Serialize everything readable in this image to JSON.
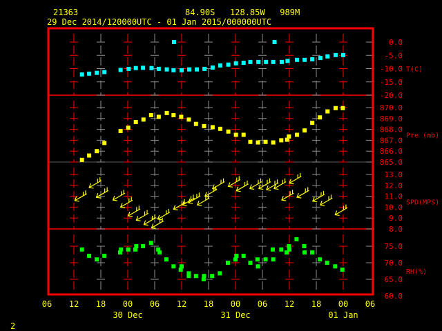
{
  "header": {
    "station_id": "21363",
    "location": "84.90S   128.85W   989M",
    "time_range": "29 Dec 2014/120000UTC - 01 Jan 2015/000000UTC"
  },
  "footer": {
    "page": "2"
  },
  "colors": {
    "frame": "#ff0000",
    "text": "#ffff00",
    "temp": "#00ffff",
    "pressure": "#ffff00",
    "wind": "#ffff00",
    "rh": "#00ff00",
    "grid_alt": "#909090"
  },
  "chart_data": {
    "type": "scatter",
    "time_unit": "hours since 29 Dec 06Z",
    "x_ticks": {
      "hours": [
        0,
        6,
        12,
        18,
        24,
        30,
        36,
        42,
        48,
        54,
        60,
        66,
        72
      ],
      "labels": [
        "06",
        "12",
        "18",
        "00",
        "06",
        "12",
        "18",
        "00",
        "06",
        "12",
        "18",
        "00",
        "06"
      ]
    },
    "date_labels": [
      {
        "hour": 18,
        "text": "30 Dec"
      },
      {
        "hour": 42,
        "text": "31 Dec"
      },
      {
        "hour": 66,
        "text": "01 Jan"
      }
    ],
    "panels": [
      {
        "id": "temp",
        "label": "T(C)",
        "ylim": [
          -20,
          0
        ],
        "ticks": [
          0,
          -5,
          -10,
          -15,
          -20
        ],
        "tick_labels": [
          "0.0",
          "-5.0",
          "-10.0",
          "-15.0",
          "-20.0"
        ],
        "points": [
          [
            7.8,
            -12.2
          ],
          [
            9.4,
            -11.9
          ],
          [
            11.1,
            -11.6
          ],
          [
            12.8,
            -11.3
          ],
          [
            16.4,
            -10.5
          ],
          [
            18.2,
            -10.1
          ],
          [
            19.8,
            -9.8
          ],
          [
            21.4,
            -9.7
          ],
          [
            23.3,
            -9.8
          ],
          [
            24.9,
            -10.1
          ],
          [
            26.7,
            -10.3
          ],
          [
            28.2,
            -10.6
          ],
          [
            30.0,
            -10.6
          ],
          [
            31.7,
            -10.3
          ],
          [
            33.4,
            -10.3
          ],
          [
            35.1,
            -10.1
          ],
          [
            36.9,
            -9.6
          ],
          [
            38.6,
            -8.8
          ],
          [
            40.4,
            -8.5
          ],
          [
            42.1,
            -8.0
          ],
          [
            43.8,
            -7.8
          ],
          [
            45.3,
            -7.5
          ],
          [
            47.1,
            -7.5
          ],
          [
            48.8,
            -7.5
          ],
          [
            50.4,
            -7.5
          ],
          [
            52.3,
            -7.5
          ],
          [
            53.6,
            -7.1
          ],
          [
            55.7,
            -6.7
          ],
          [
            57.4,
            -6.7
          ],
          [
            59.1,
            -6.5
          ],
          [
            60.9,
            -6.0
          ],
          [
            62.5,
            -5.4
          ],
          [
            64.3,
            -4.9
          ],
          [
            66.0,
            -4.9
          ],
          [
            28.3,
            0.0
          ],
          [
            50.7,
            0.0
          ]
        ]
      },
      {
        "id": "pressure",
        "label": "Pre (mb)",
        "ylim": [
          865,
          870
        ],
        "ticks": [
          870,
          869,
          868,
          867,
          866,
          865
        ],
        "tick_labels": [
          "870.0",
          "869.0",
          "868.0",
          "867.0",
          "866.0",
          "865.0"
        ],
        "points": [
          [
            7.8,
            865.2
          ],
          [
            9.4,
            865.6
          ],
          [
            11.1,
            866.0
          ],
          [
            12.8,
            866.75
          ],
          [
            16.4,
            867.85
          ],
          [
            18.1,
            868.15
          ],
          [
            19.8,
            868.67
          ],
          [
            21.5,
            868.9
          ],
          [
            23.2,
            869.3
          ],
          [
            24.9,
            869.15
          ],
          [
            26.7,
            869.5
          ],
          [
            28.2,
            869.3
          ],
          [
            29.9,
            869.15
          ],
          [
            31.6,
            868.9
          ],
          [
            33.2,
            868.5
          ],
          [
            35.0,
            868.3
          ],
          [
            36.9,
            868.2
          ],
          [
            38.6,
            868.05
          ],
          [
            40.4,
            867.8
          ],
          [
            42.1,
            867.5
          ],
          [
            43.8,
            867.5
          ],
          [
            45.3,
            866.85
          ],
          [
            47.0,
            866.8
          ],
          [
            48.7,
            866.85
          ],
          [
            50.4,
            866.8
          ],
          [
            52.2,
            867.0
          ],
          [
            53.5,
            867.05
          ],
          [
            53.9,
            867.35
          ],
          [
            55.7,
            867.5
          ],
          [
            57.4,
            867.9
          ],
          [
            59.1,
            868.6
          ],
          [
            60.8,
            869.1
          ],
          [
            62.5,
            869.65
          ],
          [
            64.3,
            869.95
          ],
          [
            65.9,
            869.95
          ]
        ]
      },
      {
        "id": "wind",
        "label": "SPD(MPS)",
        "ylim": [
          8,
          13
        ],
        "ticks": [
          13,
          12,
          11,
          10,
          9,
          8
        ],
        "tick_labels": [
          "13.0",
          "12.0",
          "11.0",
          "10.0",
          "9.0",
          "8.0"
        ],
        "points": [
          [
            6.2,
            10.6
          ],
          [
            9.4,
            11.8
          ],
          [
            11.0,
            10.9
          ],
          [
            14.7,
            10.65
          ],
          [
            16.4,
            10.0
          ],
          [
            18.1,
            9.2
          ],
          [
            19.9,
            8.8
          ],
          [
            21.6,
            8.4
          ],
          [
            23.3,
            8.1
          ],
          [
            24.7,
            8.9
          ],
          [
            28.2,
            9.8
          ],
          [
            30.2,
            10.2
          ],
          [
            31.5,
            10.4
          ],
          [
            33.5,
            10.2
          ],
          [
            35.2,
            11.0
          ],
          [
            36.9,
            11.7
          ],
          [
            40.4,
            11.9
          ],
          [
            42.2,
            11.5
          ],
          [
            45.2,
            11.7
          ],
          [
            47.2,
            11.7
          ],
          [
            48.9,
            11.6
          ],
          [
            50.6,
            11.7
          ],
          [
            52.3,
            10.65
          ],
          [
            54.0,
            12.2
          ],
          [
            55.7,
            10.9
          ],
          [
            59.2,
            10.55
          ],
          [
            60.9,
            10.2
          ],
          [
            64.2,
            9.3
          ]
        ]
      },
      {
        "id": "rh",
        "label": "RH(%)",
        "ylim": [
          60,
          75
        ],
        "ticks": [
          75,
          70,
          65,
          60
        ],
        "tick_labels": [
          "75.0",
          "70.0",
          "65.0",
          "60.0"
        ],
        "points": [
          [
            7.8,
            74.0
          ],
          [
            9.4,
            72.1
          ],
          [
            11.1,
            71.0
          ],
          [
            12.8,
            72.1
          ],
          [
            16.3,
            73.1
          ],
          [
            16.5,
            74.0
          ],
          [
            18.1,
            74.0
          ],
          [
            19.7,
            74.0
          ],
          [
            19.9,
            75.0
          ],
          [
            21.4,
            75.0
          ],
          [
            23.2,
            76.0
          ],
          [
            24.8,
            74.0
          ],
          [
            25.1,
            73.1
          ],
          [
            26.6,
            71.0
          ],
          [
            28.2,
            68.9
          ],
          [
            29.8,
            67.9
          ],
          [
            30.0,
            68.9
          ],
          [
            31.6,
            66.8
          ],
          [
            31.6,
            66.0
          ],
          [
            33.2,
            66.0
          ],
          [
            34.9,
            65.0
          ],
          [
            35.0,
            66.0
          ],
          [
            36.8,
            66.0
          ],
          [
            38.5,
            66.8
          ],
          [
            40.3,
            70.0
          ],
          [
            42.0,
            71.0
          ],
          [
            42.2,
            72.1
          ],
          [
            43.8,
            72.1
          ],
          [
            45.3,
            70.0
          ],
          [
            46.9,
            71.0
          ],
          [
            47.0,
            68.9
          ],
          [
            48.7,
            71.0
          ],
          [
            50.4,
            71.0
          ],
          [
            50.3,
            74.0
          ],
          [
            52.2,
            74.0
          ],
          [
            53.4,
            73.1
          ],
          [
            53.9,
            75.0
          ],
          [
            54.0,
            74.0
          ],
          [
            55.6,
            77.1
          ],
          [
            57.3,
            75.0
          ],
          [
            57.4,
            73.1
          ],
          [
            59.1,
            73.1
          ],
          [
            60.8,
            71.0
          ],
          [
            62.4,
            70.0
          ],
          [
            64.2,
            68.9
          ],
          [
            65.8,
            67.9
          ]
        ]
      }
    ]
  }
}
